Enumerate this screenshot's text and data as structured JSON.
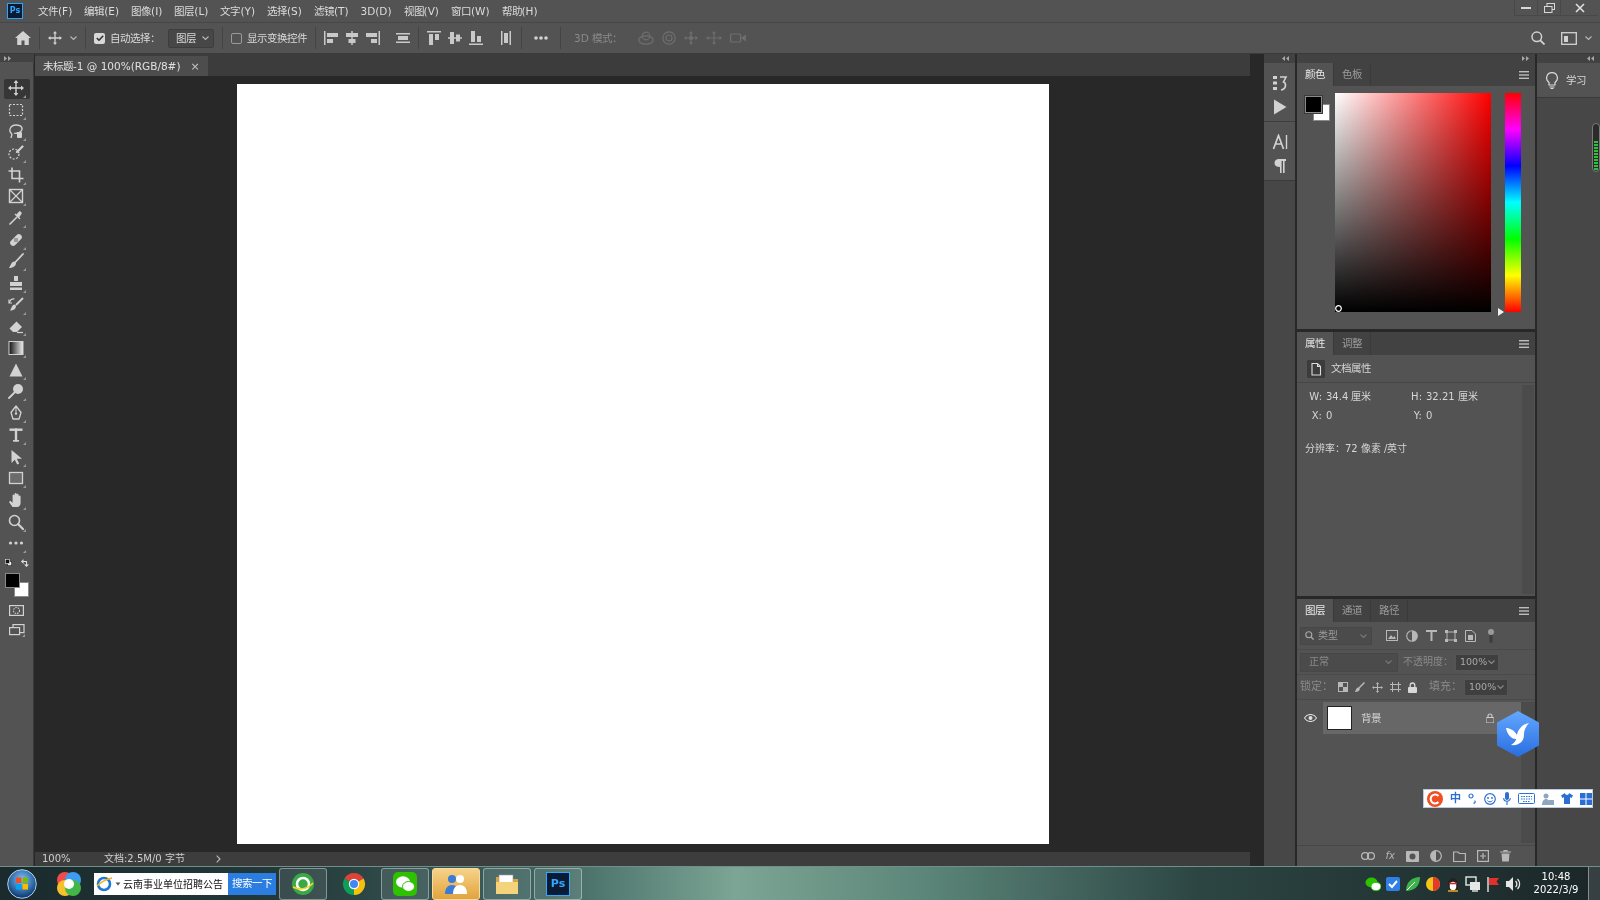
{
  "app": {
    "logo": "Ps"
  },
  "menu_bar": [
    "文件(F)",
    "编辑(E)",
    "图像(I)",
    "图层(L)",
    "文字(Y)",
    "选择(S)",
    "滤镜(T)",
    "3D(D)",
    "视图(V)",
    "窗口(W)",
    "帮助(H)"
  ],
  "options_bar": {
    "auto_select": {
      "label": "自动选择：",
      "checked": true
    },
    "target": "图层",
    "show_transform": {
      "label": "显示变换控件",
      "checked": false
    },
    "mode_3d": {
      "label": "3D 模式：",
      "disabled": true
    }
  },
  "document_tab": {
    "title": "未标题-1 @ 100%(RGB/8#)",
    "close": "×",
    "selected": true
  },
  "tools": [
    {
      "kind": "move",
      "selected": true
    },
    {
      "kind": "marquee",
      "selected": false
    },
    {
      "kind": "lasso",
      "selected": false
    },
    {
      "kind": "quickselect",
      "selected": false
    },
    {
      "kind": "crop",
      "selected": false
    },
    {
      "kind": "frame",
      "selected": false
    },
    {
      "kind": "eyedropper",
      "selected": false
    },
    {
      "kind": "healing",
      "selected": false
    },
    {
      "kind": "brush",
      "selected": false
    },
    {
      "kind": "stamp",
      "selected": false
    },
    {
      "kind": "historybrush",
      "selected": false
    },
    {
      "kind": "eraser",
      "selected": false
    },
    {
      "kind": "gradient",
      "selected": false
    },
    {
      "kind": "sharpen",
      "selected": false
    },
    {
      "kind": "dodge",
      "selected": false
    },
    {
      "kind": "pen",
      "selected": false
    },
    {
      "kind": "type",
      "selected": false
    },
    {
      "kind": "pathselect",
      "selected": false
    },
    {
      "kind": "rectangle",
      "selected": false
    },
    {
      "kind": "hand",
      "selected": false
    },
    {
      "kind": "zoom",
      "selected": false
    },
    {
      "kind": "more",
      "selected": false
    }
  ],
  "tool_colors": [
    {
      "color": "#000000"
    },
    {
      "color": "#ffffff"
    }
  ],
  "color_panel": {
    "tabs": [
      {
        "label": "颜色",
        "selected": true
      },
      {
        "label": "色板",
        "selected": false
      }
    ],
    "swatches": [
      {
        "color": "#000000"
      },
      {
        "color": "#ffffff"
      }
    ],
    "hue_slider": {
      "level": 0
    }
  },
  "properties_panel": {
    "tabs": [
      {
        "label": "属性",
        "selected": true
      },
      {
        "label": "调整",
        "selected": false
      }
    ],
    "title": "文档属性",
    "fields": [
      {
        "label": "W:",
        "value": "34.4 厘米"
      },
      {
        "label": "H:",
        "value": "32.21 厘米"
      },
      {
        "label": "X:",
        "value": "0"
      },
      {
        "label": "Y:",
        "value": "0"
      }
    ],
    "resolution": "分辨率：72 像素 /英寸"
  },
  "layers_panel": {
    "tabs": [
      {
        "label": "图层",
        "selected": true
      },
      {
        "label": "通道",
        "selected": false
      },
      {
        "label": "路径",
        "selected": false
      }
    ],
    "filter": {
      "value": "类型",
      "on": false
    },
    "blend_mode": {
      "value": "正常",
      "disabled": true
    },
    "opacity": {
      "label": "不透明度：",
      "value": "100%",
      "disabled": true
    },
    "lock": {
      "label": "锁定：",
      "disabled": true
    },
    "fill": {
      "label": "填充：",
      "value": "100%",
      "disabled": true
    },
    "layers": [
      {
        "name": "背景",
        "visible": true,
        "locked": true,
        "selected": true
      }
    ],
    "effects_button": "fx"
  },
  "learn_panel": {
    "label": "学习"
  },
  "status_bar": {
    "zoom": "100%",
    "document": "文档:2.5M/0 字节"
  },
  "taskbar": {
    "search": {
      "value": "云南事业单位招聘公告",
      "button": "搜索一下"
    },
    "apps": [
      {
        "kind": "browser360",
        "open": true,
        "attention": false
      },
      {
        "kind": "chrome",
        "open": false,
        "attention": false
      },
      {
        "kind": "wechat",
        "open": true,
        "attention": false
      },
      {
        "kind": "meeting",
        "open": true,
        "attention": true
      },
      {
        "kind": "explorer",
        "open": true,
        "attention": false
      },
      {
        "kind": "photoshop",
        "label": "Ps",
        "open": true,
        "attention": false
      }
    ],
    "clock": {
      "time": "10:48",
      "date": "2022/3/9"
    }
  },
  "ime_bar": {
    "mode": "中"
  }
}
